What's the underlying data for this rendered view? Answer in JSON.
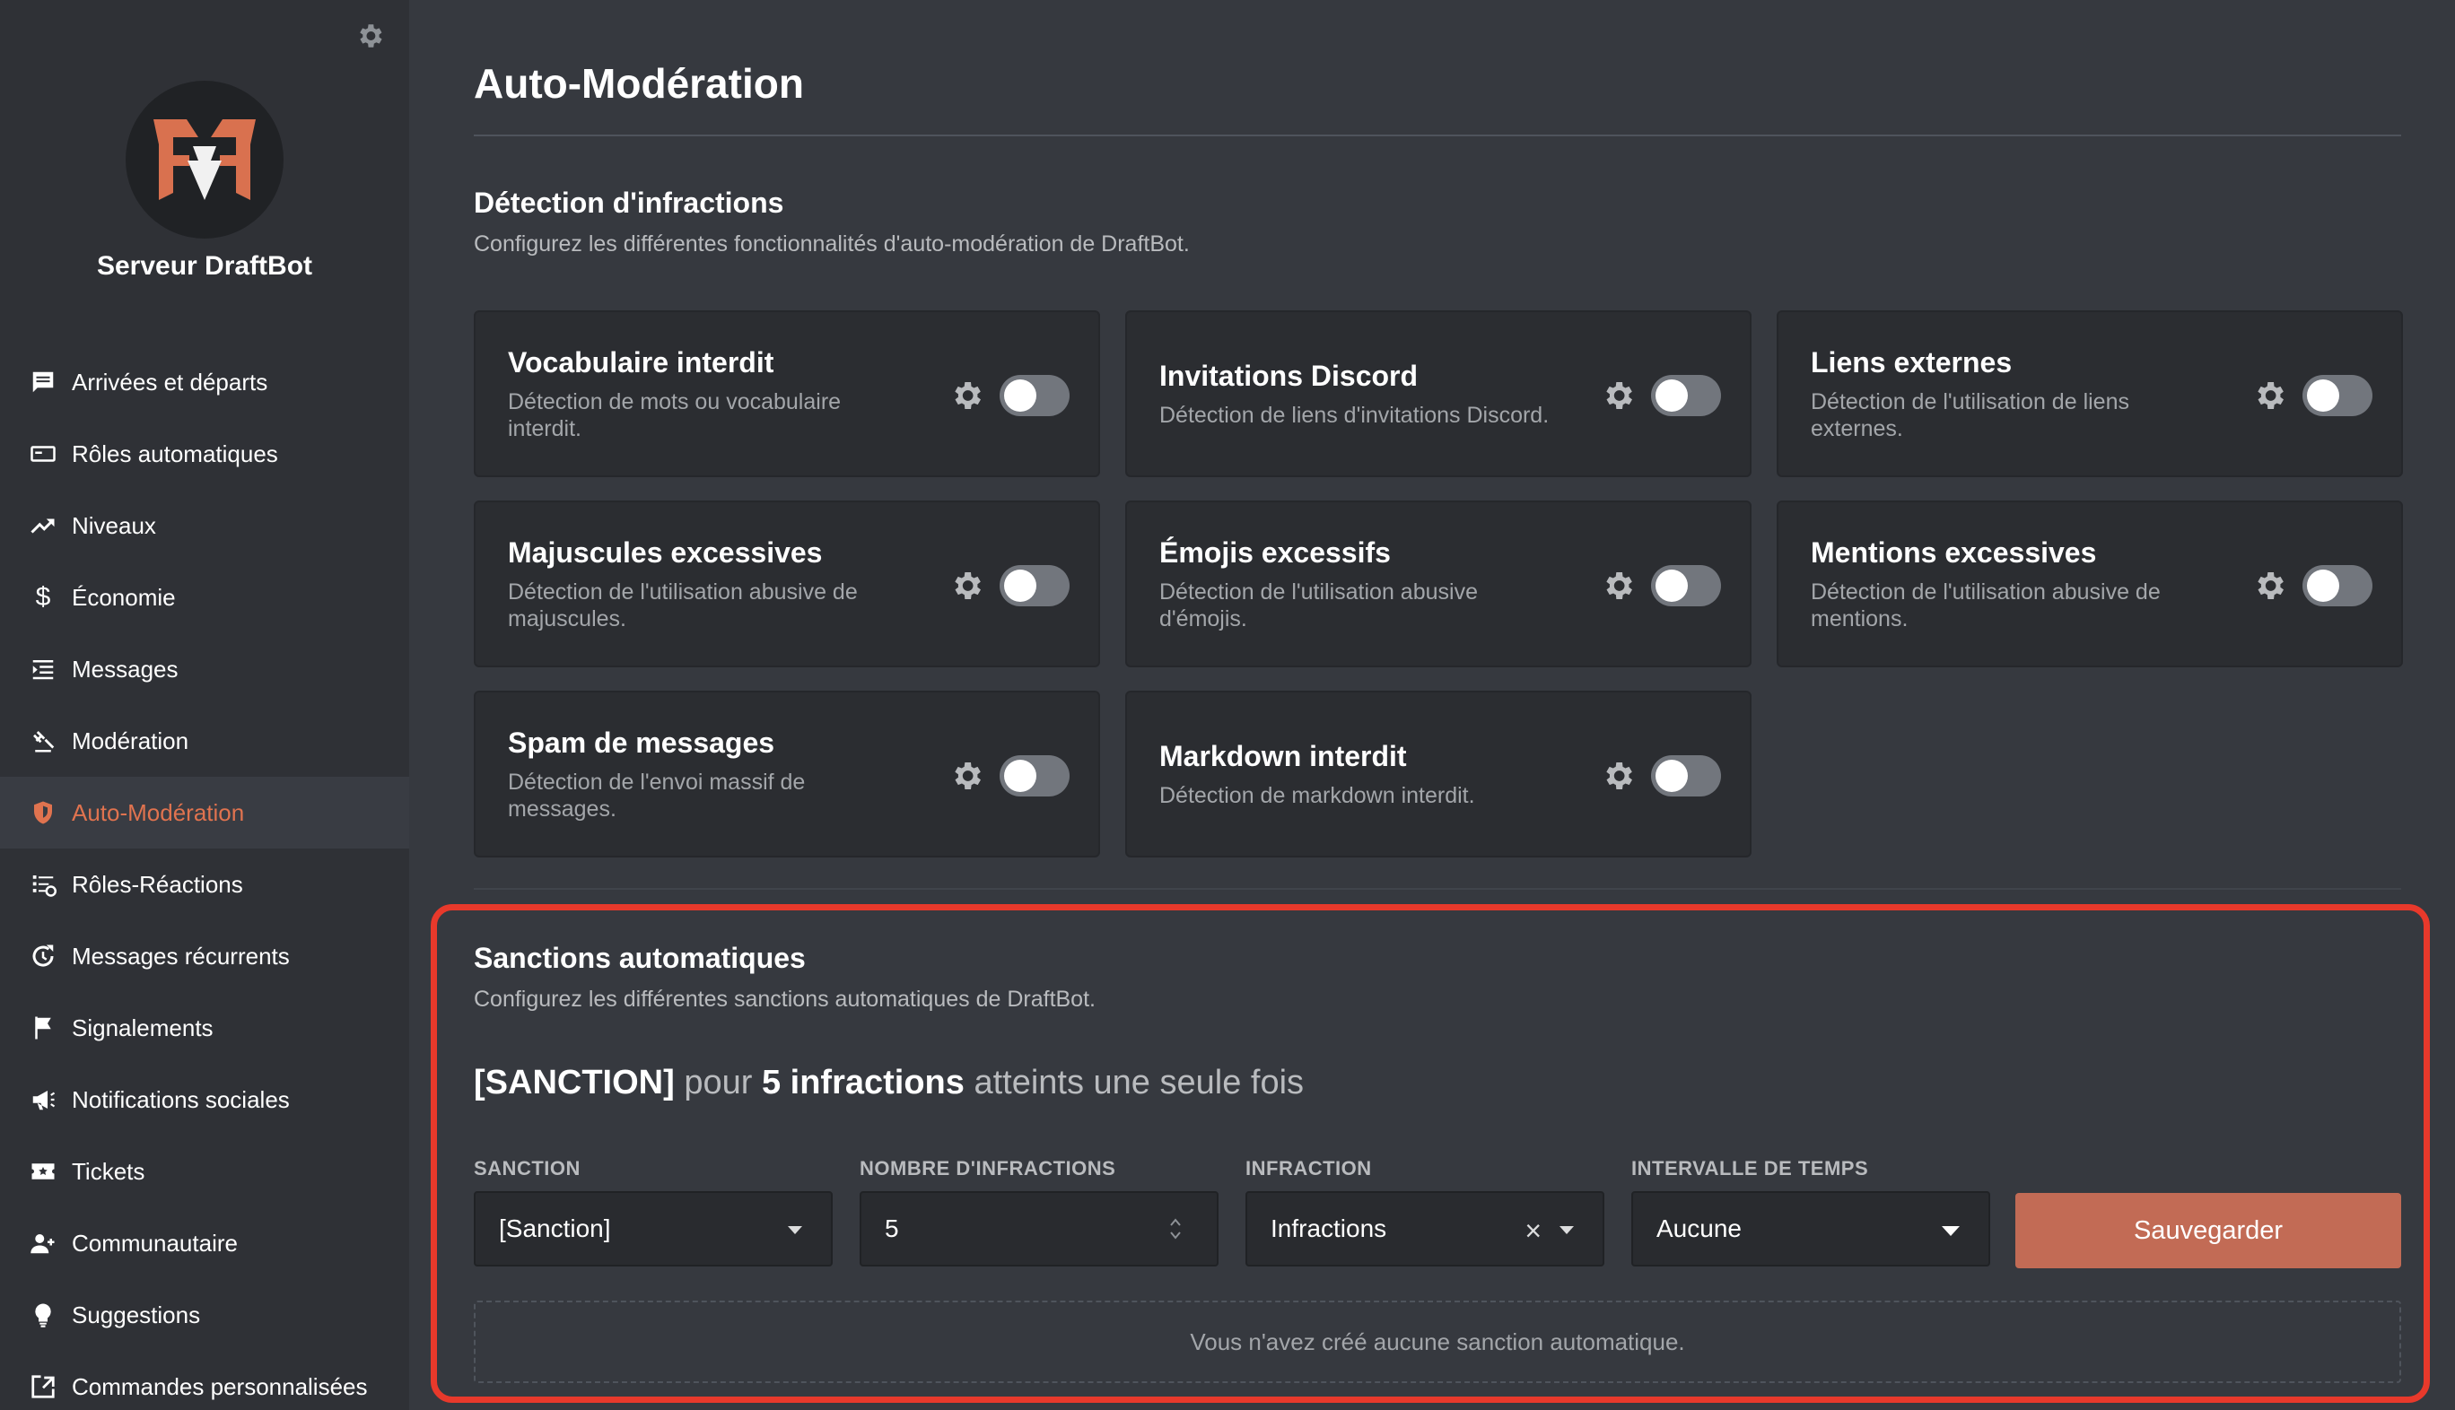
{
  "colors": {
    "accent": "#e0734f",
    "save_button": "#c26b55",
    "highlight_border": "#e8392b",
    "background": "#36393f",
    "sidebar_bg": "#2f3136",
    "card_bg": "#2b2d31"
  },
  "sidebar": {
    "server_name": "Serveur DraftBot",
    "items": [
      {
        "label": "Arrivées et départs",
        "icon": "message-icon"
      },
      {
        "label": "Rôles automatiques",
        "icon": "id-card-icon"
      },
      {
        "label": "Niveaux",
        "icon": "trending-up-icon"
      },
      {
        "label": "Économie",
        "icon": "dollar-icon"
      },
      {
        "label": "Messages",
        "icon": "list-icon"
      },
      {
        "label": "Modération",
        "icon": "gavel-icon"
      },
      {
        "label": "Auto-Modération",
        "icon": "shield-icon",
        "active": true
      },
      {
        "label": "Rôles-Réactions",
        "icon": "list-add-icon"
      },
      {
        "label": "Messages récurrents",
        "icon": "refresh-icon"
      },
      {
        "label": "Signalements",
        "icon": "flag-icon"
      },
      {
        "label": "Notifications sociales",
        "icon": "megaphone-icon"
      },
      {
        "label": "Tickets",
        "icon": "ticket-icon"
      },
      {
        "label": "Communautaire",
        "icon": "users-icon"
      },
      {
        "label": "Suggestions",
        "icon": "lightbulb-icon"
      },
      {
        "label": "Commandes personnalisées",
        "icon": "add-command-icon"
      }
    ]
  },
  "main": {
    "title": "Auto-Modération",
    "detection": {
      "title": "Détection d'infractions",
      "description": "Configurez les différentes fonctionnalités d'auto-modération de DraftBot.",
      "cards": [
        {
          "title": "Vocabulaire interdit",
          "desc": "Détection de mots ou vocabulaire interdit.",
          "enabled": false
        },
        {
          "title": "Invitations Discord",
          "desc": "Détection de liens d'invitations Discord.",
          "enabled": false
        },
        {
          "title": "Liens externes",
          "desc": "Détection de l'utilisation de liens externes.",
          "enabled": false
        },
        {
          "title": "Majuscules excessives",
          "desc": "Détection de l'utilisation abusive de majuscules.",
          "enabled": false
        },
        {
          "title": "Émojis excessifs",
          "desc": "Détection de l'utilisation abusive d'émojis.",
          "enabled": false
        },
        {
          "title": "Mentions excessives",
          "desc": "Détection de l'utilisation abusive de mentions.",
          "enabled": false
        },
        {
          "title": "Spam de messages",
          "desc": "Détection de l'envoi massif de messages.",
          "enabled": false
        },
        {
          "title": "Markdown interdit",
          "desc": "Détection de markdown interdit.",
          "enabled": false
        }
      ]
    },
    "sanctions": {
      "title": "Sanctions automatiques",
      "description": "Configurez les différentes sanctions automatiques de DraftBot.",
      "rule": {
        "sanction": "[SANCTION]",
        "pour": "pour",
        "count": "5 infractions",
        "suffix": "atteints une seule fois"
      },
      "fields": {
        "sanction_label": "SANCTION",
        "sanction_value": "[Sanction]",
        "count_label": "NOMBRE D'INFRACTIONS",
        "count_value": "5",
        "infraction_label": "INFRACTION",
        "infraction_value": "Infractions",
        "interval_label": "INTERVALLE DE TEMPS",
        "interval_value": "Aucune"
      },
      "save_label": "Sauvegarder",
      "empty_text": "Vous n'avez créé aucune sanction automatique."
    }
  }
}
